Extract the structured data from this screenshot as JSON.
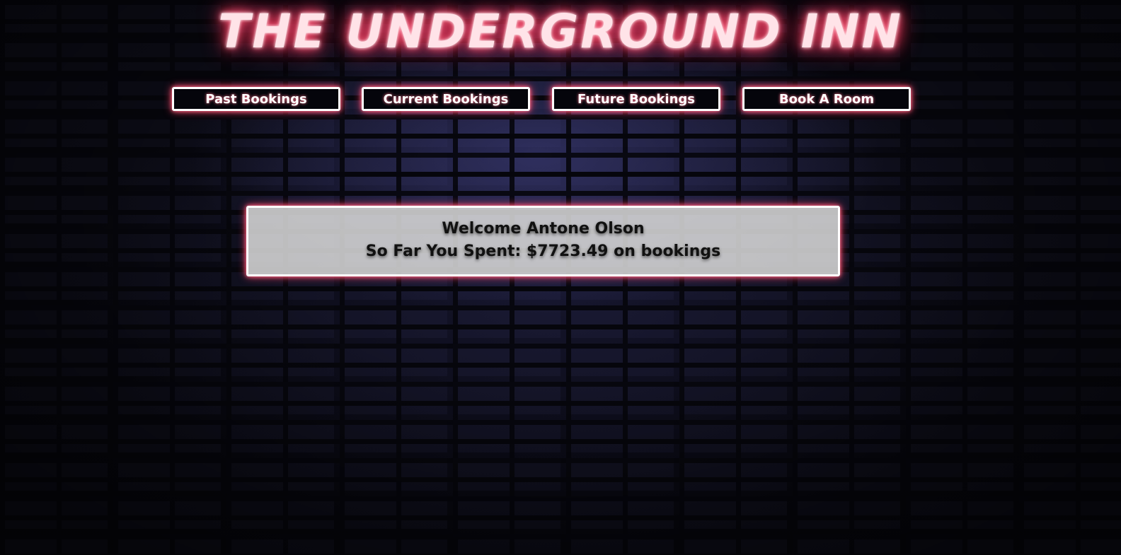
{
  "header": {
    "title": "THE UNDERGROUND INN"
  },
  "nav": {
    "items": [
      {
        "label": "Past Bookings"
      },
      {
        "label": "Current Bookings"
      },
      {
        "label": "Future Bookings"
      },
      {
        "label": "Book A Room"
      }
    ]
  },
  "welcome": {
    "greeting": "Welcome Antone Olson",
    "spent_line": "So Far You Spent: $7723.49 on bookings"
  },
  "colors": {
    "neon_glow": "#ff3d63",
    "button_background": "#05050b",
    "panel_background": "#d7d7d7"
  }
}
